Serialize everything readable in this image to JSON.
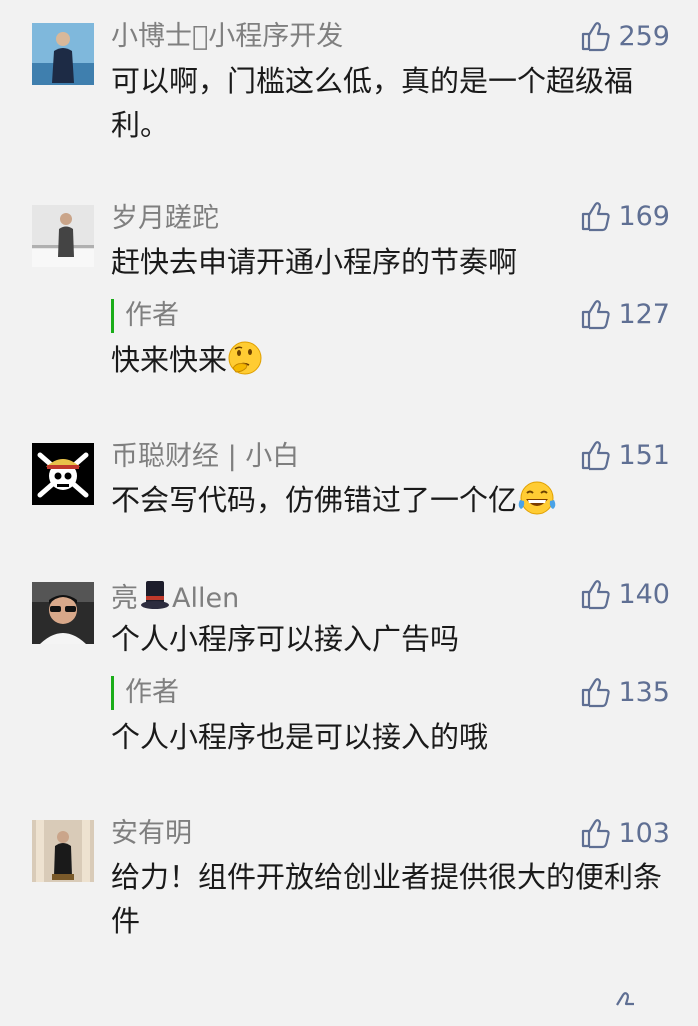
{
  "comments": [
    {
      "name": "小博士\u0000小程序开发",
      "likes": "259",
      "text": "可以啊，门槛这么低，真的是一个超级福利。"
    },
    {
      "name": "岁月蹉跎",
      "likes": "169",
      "text": "赶快去申请开通小程序的节奏啊",
      "reply": {
        "label": "作者",
        "likes": "127",
        "text": "快来快来"
      }
    },
    {
      "name": "币聪财经 | 小白",
      "likes": "151",
      "text": "不会写代码，仿佛错过了一个亿"
    },
    {
      "name": "亮",
      "name_suffix": "Allen",
      "likes": "140",
      "text": "个人小程序可以接入广告吗",
      "reply": {
        "label": "作者",
        "likes": "135",
        "text": "个人小程序也是可以接入的哦"
      }
    },
    {
      "name": "安有明",
      "likes": "103",
      "text": "给力！组件开放给创业者提供很大的便利条件"
    }
  ],
  "icons": {
    "like": "thumbs-up-icon",
    "emoji_thinking": "thinking-face-icon",
    "emoji_laughing": "tears-of-joy-icon",
    "hat": "top-hat-icon"
  },
  "colors": {
    "accent_author": "#1aad19",
    "like": "#5f6f93"
  }
}
